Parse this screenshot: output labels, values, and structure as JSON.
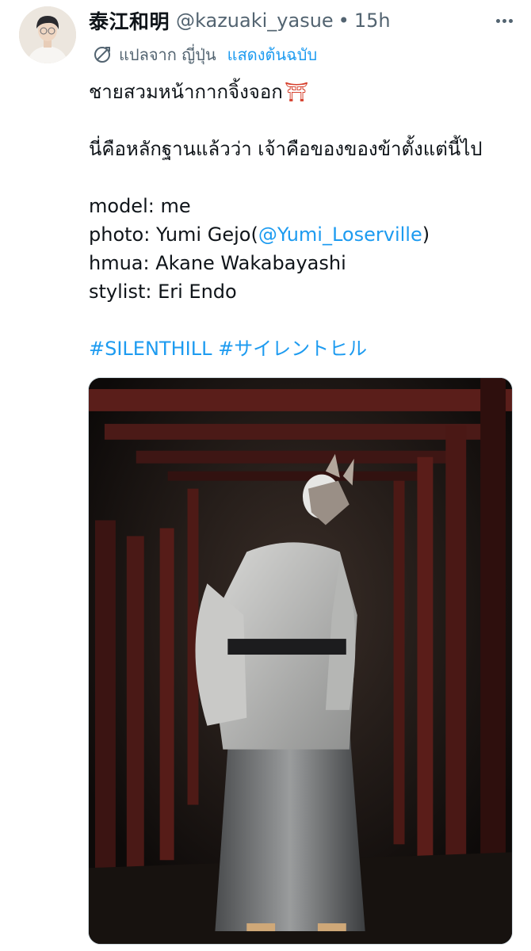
{
  "tweet": {
    "author": {
      "display_name": "泰江和明",
      "handle": "@kazuaki_yasue",
      "separator": "•",
      "time": "15h"
    },
    "translation": {
      "label": "แปลจาก ญี่ปุ่น",
      "show_original": "แสดงต้นฉบับ"
    },
    "lines": {
      "line1": "ชายสวมหน้ากากจิ้งจอก",
      "line1_emoji": "⛩",
      "line2": "นี่คือหลักฐานแล้วว่า เจ้าคือของของข้าตั้งแต่นี้ไป",
      "model": "model: me",
      "photo_prefix": "photo: Yumi Gejo(",
      "photo_mention": "@Yumi_Loserville",
      "photo_suffix": ")",
      "hmua": "hmua: Akane Wakabayashi",
      "stylist": "stylist: Eri Endo"
    },
    "hashtags": [
      "#SILENTHILL",
      "#サイレントヒル"
    ]
  },
  "icons": {
    "more": "more-horizontal-icon",
    "translate": "translate-globe-icon",
    "emoji": "shinto-shrine-icon"
  },
  "colors": {
    "link": "#1d9bf0",
    "secondary_text": "#536471",
    "primary_text": "#0f1419"
  }
}
